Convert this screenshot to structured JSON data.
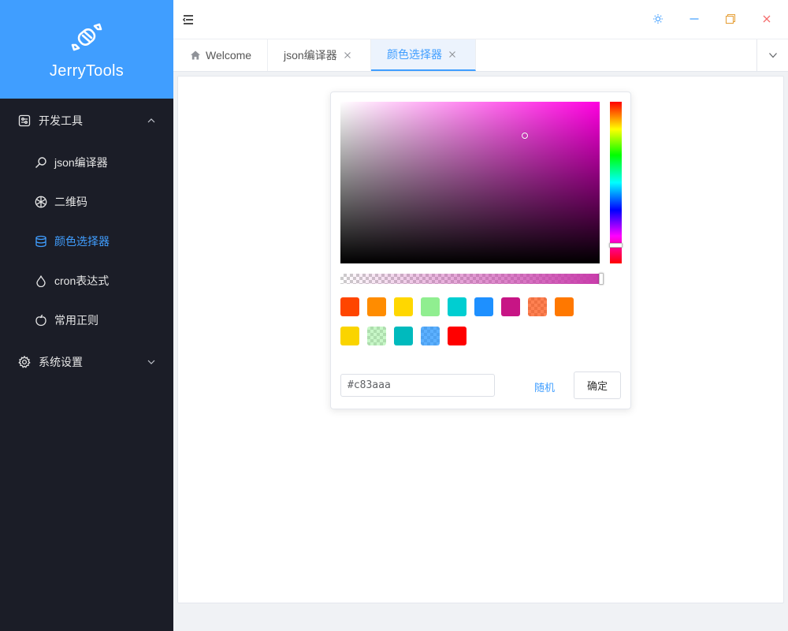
{
  "app": {
    "title": "JerryTools"
  },
  "colors": {
    "accent": "#409eff",
    "sidebar_bg": "#1b1d27",
    "current_hue": "#ff00e0",
    "current_color": "#c83aaa"
  },
  "sidebar": {
    "groups": [
      {
        "label": "开发工具",
        "icon": "toolbox-icon",
        "expanded": true,
        "items": [
          {
            "label": "json编译器",
            "icon": "search-magnifier-icon"
          },
          {
            "label": "二维码",
            "icon": "aperture-icon"
          },
          {
            "label": "颜色选择器",
            "icon": "database-icon",
            "active": true
          },
          {
            "label": "cron表达式",
            "icon": "droplet-icon"
          },
          {
            "label": "常用正则",
            "icon": "apple-icon"
          }
        ]
      },
      {
        "label": "系统设置",
        "icon": "gear-icon",
        "expanded": false
      }
    ]
  },
  "header": {
    "menu_toggle_icon": "hamburger-icon",
    "window_buttons": [
      "theme-sun-icon",
      "minimize-icon",
      "maximize-icon",
      "close-icon"
    ]
  },
  "tabs": [
    {
      "label": "Welcome",
      "icon": "home-icon",
      "closable": false
    },
    {
      "label": "json编译器",
      "closable": true
    },
    {
      "label": "颜色选择器",
      "closable": true,
      "active": true
    }
  ],
  "color_picker": {
    "hex_value": "#c83aaa",
    "random_label": "随机",
    "confirm_label": "确定",
    "alpha": 1.0,
    "hue": 0.86,
    "saturation": 0.71,
    "brightness": 0.79,
    "predefine": [
      {
        "color": "#ff4500",
        "alpha": 1
      },
      {
        "color": "#ff8c00",
        "alpha": 1
      },
      {
        "color": "#ffd700",
        "alpha": 1
      },
      {
        "color": "#90ee90",
        "alpha": 1
      },
      {
        "color": "#00ced1",
        "alpha": 1
      },
      {
        "color": "#1e90ff",
        "alpha": 1
      },
      {
        "color": "#c71585",
        "alpha": 1
      },
      {
        "color": "#ff4500",
        "alpha": 0.68
      },
      {
        "color": "#ff7800",
        "alpha": 1
      },
      {
        "color": "#fad400",
        "alpha": 1
      },
      {
        "color": "#90f090",
        "alpha": 0.5
      },
      {
        "color": "#00babd",
        "alpha": 1
      },
      {
        "color": "#1f93ff",
        "alpha": 0.73
      },
      {
        "color": "#ff0000",
        "alpha": 1
      }
    ]
  }
}
